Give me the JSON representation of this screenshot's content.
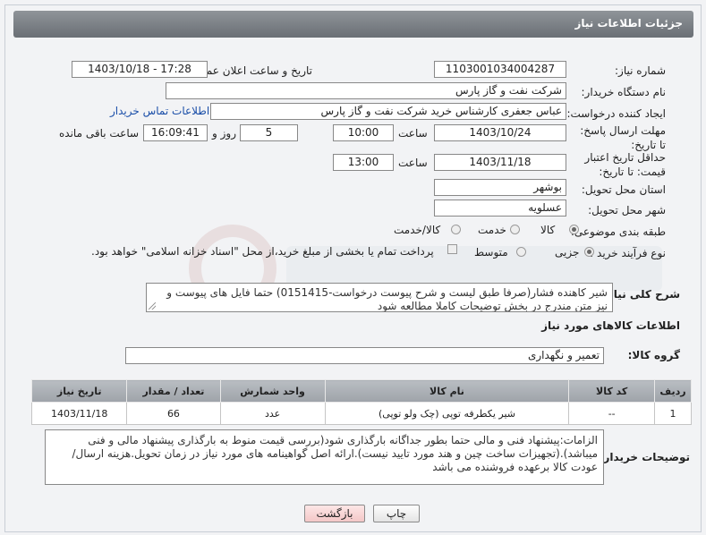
{
  "header": {
    "title": "جزئیات اطلاعات نیاز"
  },
  "fields": {
    "need_number": {
      "label": "شماره نیاز:",
      "value": "1103001034004287"
    },
    "announce_datetime": {
      "label": "تاریخ و ساعت اعلان عمومی:",
      "value": "1403/10/18 - 17:28"
    },
    "buyer_org": {
      "label": "نام دستگاه خریدار:",
      "value": "شرکت نفت و گاز پارس"
    },
    "requester": {
      "label": "ایجاد کننده درخواست:",
      "value": "عباس  جعفری کارشناس خرید  شرکت نفت و گاز پارس"
    },
    "buyer_contact_link": "اطلاعات تماس خریدار",
    "reply_deadline": {
      "label": "مهلت ارسال پاسخ: تا تاریخ:",
      "date": "1403/10/24",
      "time_label": "ساعت",
      "time": "10:00",
      "days": "5",
      "days_label": "روز و",
      "remaining": "16:09:41",
      "remaining_label": "ساعت باقی مانده"
    },
    "price_validity": {
      "label": "حداقل تاریخ اعتبار قیمت: تا تاریخ:",
      "date": "1403/11/18",
      "time_label": "ساعت",
      "time": "13:00"
    },
    "province": {
      "label": "استان محل تحویل:",
      "value": "بوشهر"
    },
    "city": {
      "label": "شهر محل تحویل:",
      "value": "عسلویه"
    },
    "category": {
      "label": "طبقه بندی موضوعی:",
      "options": [
        "کالا",
        "خدمت",
        "کالا/خدمت"
      ],
      "selected": "کالا"
    },
    "purchase_type": {
      "label": "نوع فرآیند خرید :",
      "options": [
        "جزیی",
        "متوسط"
      ],
      "selected": "جزیی",
      "payment_note": "پرداخت تمام یا بخشی از مبلغ خرید،از محل \"اسناد خزانه اسلامی\" خواهد بود."
    },
    "general_description": {
      "label": "شرح کلی نیاز:",
      "value": "شیر کاهنده فشار(صرفا طبق لیست و شرح پیوست درخواست-0151415) حتما فایل های پیوست و نیز متن مندرج در بخش توضیحات کاملا مطالعه شود"
    }
  },
  "goods_section": {
    "title": "اطلاعات کالاهای مورد نیاز",
    "group_label": "گروه کالا:",
    "group_value": "تعمیر و نگهداری"
  },
  "table": {
    "headers": [
      "ردیف",
      "کد کالا",
      "نام کالا",
      "واحد شمارش",
      "تعداد / مقدار",
      "تاریخ نیاز"
    ],
    "rows": [
      [
        "1",
        "--",
        "شیر یکطرفه توپی (چک ولو توپی)",
        "عدد",
        "66",
        "1403/11/18"
      ]
    ]
  },
  "buyer_notes": {
    "label": "توضیحات خریدار:",
    "value": "الزامات:پیشنهاد فنی و مالی حتما  بطور جداگانه بارگذاری شود(بررسی قیمت منوط به بارگذاری پیشنهاد مالی و فنی میباشد).(تجهیزات ساخت چین و هند مورد تایید نیست).ارائه اصل گواهینامه های مورد نیاز در زمان تحویل.هزینه ارسال/عودت کالا برعهده فروشنده می باشد"
  },
  "buttons": {
    "print": "چاپ",
    "back": "بازگشت"
  },
  "colors": {
    "header_bg": "#7d8288",
    "table_header_bg": "#aeb2b7",
    "link": "#1a4ea8",
    "back_button_bg": "#f8d7d7"
  }
}
